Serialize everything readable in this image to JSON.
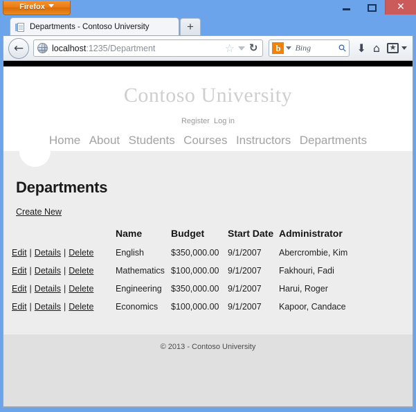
{
  "browser": {
    "app_button": "Firefox",
    "window_controls": {
      "minimize": "–",
      "maximize": "□",
      "close": "✕"
    },
    "tab": {
      "title": "Departments - Contoso University",
      "favicon": "page-icon",
      "new_tab": "+"
    },
    "toolbar": {
      "back": "←",
      "url_host": "localhost",
      "url_path": ":1235/Department",
      "star": "☆",
      "reload": "↻",
      "download": "⬇",
      "home": "⌂",
      "bookmarks": "★",
      "search": {
        "engine_icon": "b",
        "placeholder": "Bing",
        "magnifier": "⚲"
      }
    }
  },
  "site": {
    "brand": "Contoso University",
    "auth_links": [
      {
        "label": "Register"
      },
      {
        "label": "Log in"
      }
    ],
    "nav_links": [
      {
        "label": "Home"
      },
      {
        "label": "About"
      },
      {
        "label": "Students"
      },
      {
        "label": "Courses"
      },
      {
        "label": "Instructors"
      },
      {
        "label": "Departments"
      }
    ],
    "footer": "© 2013 - Contoso University"
  },
  "page": {
    "title": "Departments",
    "create_new": "Create New",
    "table": {
      "headers": {
        "actions": "",
        "name": "Name",
        "budget": "Budget",
        "start_date": "Start Date",
        "administrator": "Administrator"
      },
      "actions": {
        "edit": "Edit",
        "details": "Details",
        "delete": "Delete",
        "separator": "|"
      },
      "rows": [
        {
          "name": "English",
          "budget": "$350,000.00",
          "start_date": "9/1/2007",
          "administrator": "Abercrombie, Kim"
        },
        {
          "name": "Mathematics",
          "budget": "$100,000.00",
          "start_date": "9/1/2007",
          "administrator": "Fakhouri, Fadi"
        },
        {
          "name": "Engineering",
          "budget": "$350,000.00",
          "start_date": "9/1/2007",
          "administrator": "Harui, Roger"
        },
        {
          "name": "Economics",
          "budget": "$100,000.00",
          "start_date": "9/1/2007",
          "administrator": "Kapoor, Candace"
        }
      ]
    }
  },
  "colors": {
    "window_frame": "#6ba4ea",
    "firefox_orange": "#ea7b13",
    "close_red": "#cb5a5a",
    "content_gray": "#ededed",
    "footer_gray": "#e0e0e0",
    "brand_gray": "#cfcfcf",
    "nav_gray": "#a3a3a3",
    "bing_orange": "#f0820c"
  }
}
